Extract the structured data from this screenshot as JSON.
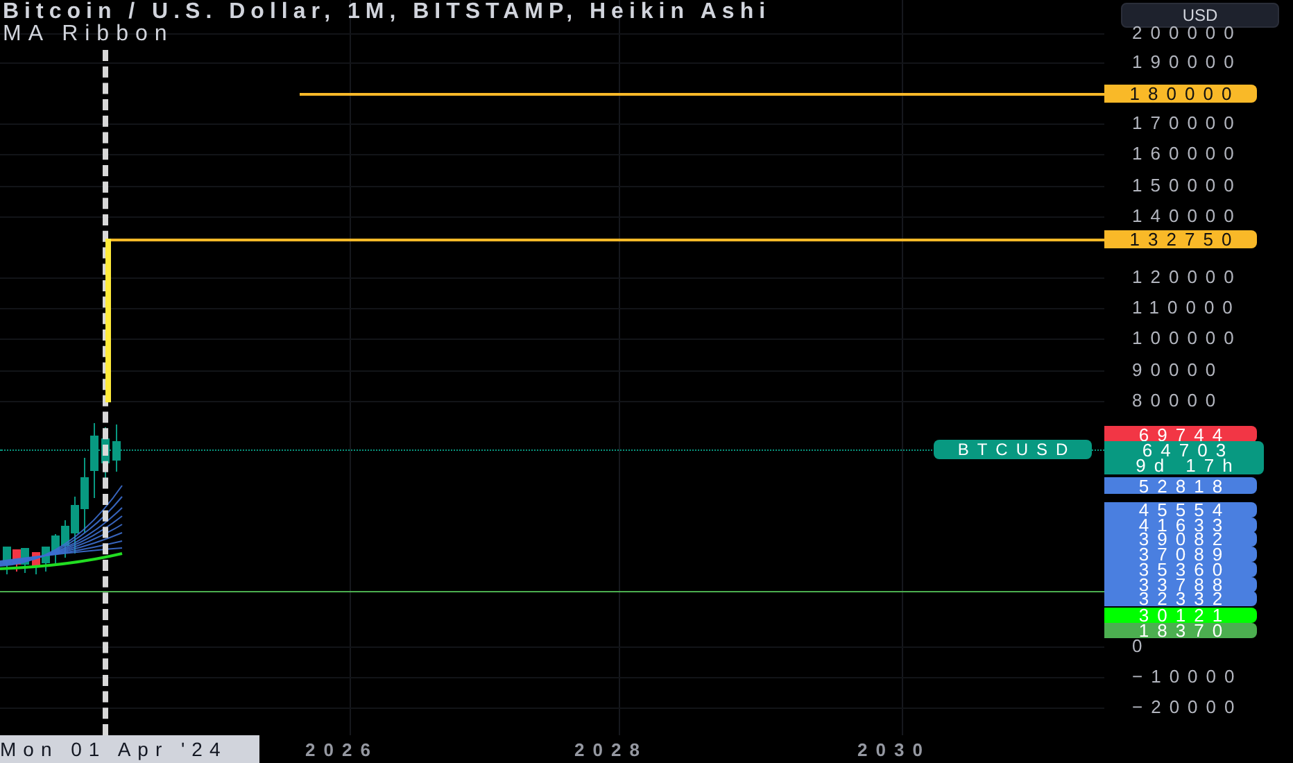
{
  "header": {
    "title": "Bitcoin / U.S. Dollar, 1M, BITSTAMP, Heikin Ashi",
    "indicator": "MA Ribbon"
  },
  "currency_button": {
    "label": "USD"
  },
  "price_axis": {
    "ticks": [
      "200000",
      "190000",
      "170000",
      "160000",
      "150000",
      "140000",
      "120000",
      "110000",
      "100000",
      "90000",
      "80000",
      "0",
      "−10000",
      "−20000"
    ]
  },
  "price_tags": [
    {
      "label": "180000",
      "color": "#f9b928"
    },
    {
      "label": "132750",
      "color": "#f9b928"
    },
    {
      "label": "69744",
      "color": "#f23645"
    },
    {
      "label": "64703",
      "sublabel": "9d 17h",
      "color": "#089981"
    },
    {
      "label": "52818",
      "color": "#4a7fe0"
    },
    {
      "label": "45554",
      "color": "#4a7fe0"
    },
    {
      "label": "41633",
      "color": "#4a7fe0"
    },
    {
      "label": "39082",
      "color": "#4a7fe0"
    },
    {
      "label": "37089",
      "color": "#4a7fe0"
    },
    {
      "label": "35360",
      "color": "#4a7fe0"
    },
    {
      "label": "33788",
      "color": "#4a7fe0"
    },
    {
      "label": "32332",
      "color": "#4a7fe0"
    },
    {
      "label": "30121",
      "color": "#00ff00"
    },
    {
      "label": "18370",
      "color": "#4caf50"
    }
  ],
  "symbol_tag": {
    "label": "BTCUSD"
  },
  "time_axis": {
    "cursor_label": "Mon 01 Apr '24",
    "ticks": [
      "2026",
      "2028",
      "2030"
    ]
  }
}
